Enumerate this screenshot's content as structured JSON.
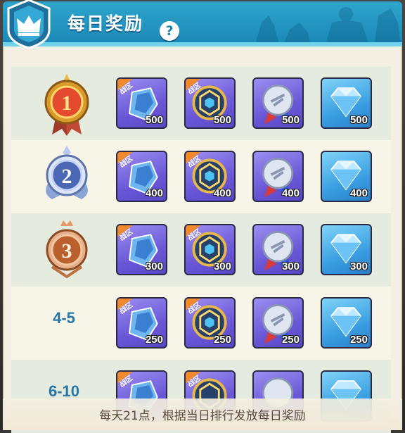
{
  "header": {
    "title": "每日奖励",
    "help_label": "?"
  },
  "item_tag": "战区",
  "rows": [
    {
      "rank": "1",
      "rank_style": "gold",
      "quantities": [
        "500",
        "500",
        "500",
        "500"
      ]
    },
    {
      "rank": "2",
      "rank_style": "silver",
      "quantities": [
        "400",
        "400",
        "400",
        "400"
      ]
    },
    {
      "rank": "3",
      "rank_style": "bronze",
      "quantities": [
        "300",
        "300",
        "300",
        "300"
      ]
    },
    {
      "rank": "4-5",
      "rank_style": "text",
      "quantities": [
        "250",
        "250",
        "250",
        "250"
      ]
    },
    {
      "rank": "6-10",
      "rank_style": "text",
      "quantities": [
        "",
        "",
        "",
        ""
      ]
    }
  ],
  "items": [
    {
      "icon": "crystal-ore-icon",
      "tagged": true
    },
    {
      "icon": "honeycomb-emblem-icon",
      "tagged": true
    },
    {
      "icon": "silver-medal-icon",
      "tagged": false
    },
    {
      "icon": "diamond-icon",
      "tagged": false
    }
  ],
  "footer": {
    "note": "每天21点，根据当日排行发放每日奖励"
  },
  "colors": {
    "header_blue": "#1a86b6",
    "rank_text": "#2677a8",
    "gold": "#d89a2a",
    "silver": "#8aa4d6",
    "bronze": "#c07040"
  }
}
